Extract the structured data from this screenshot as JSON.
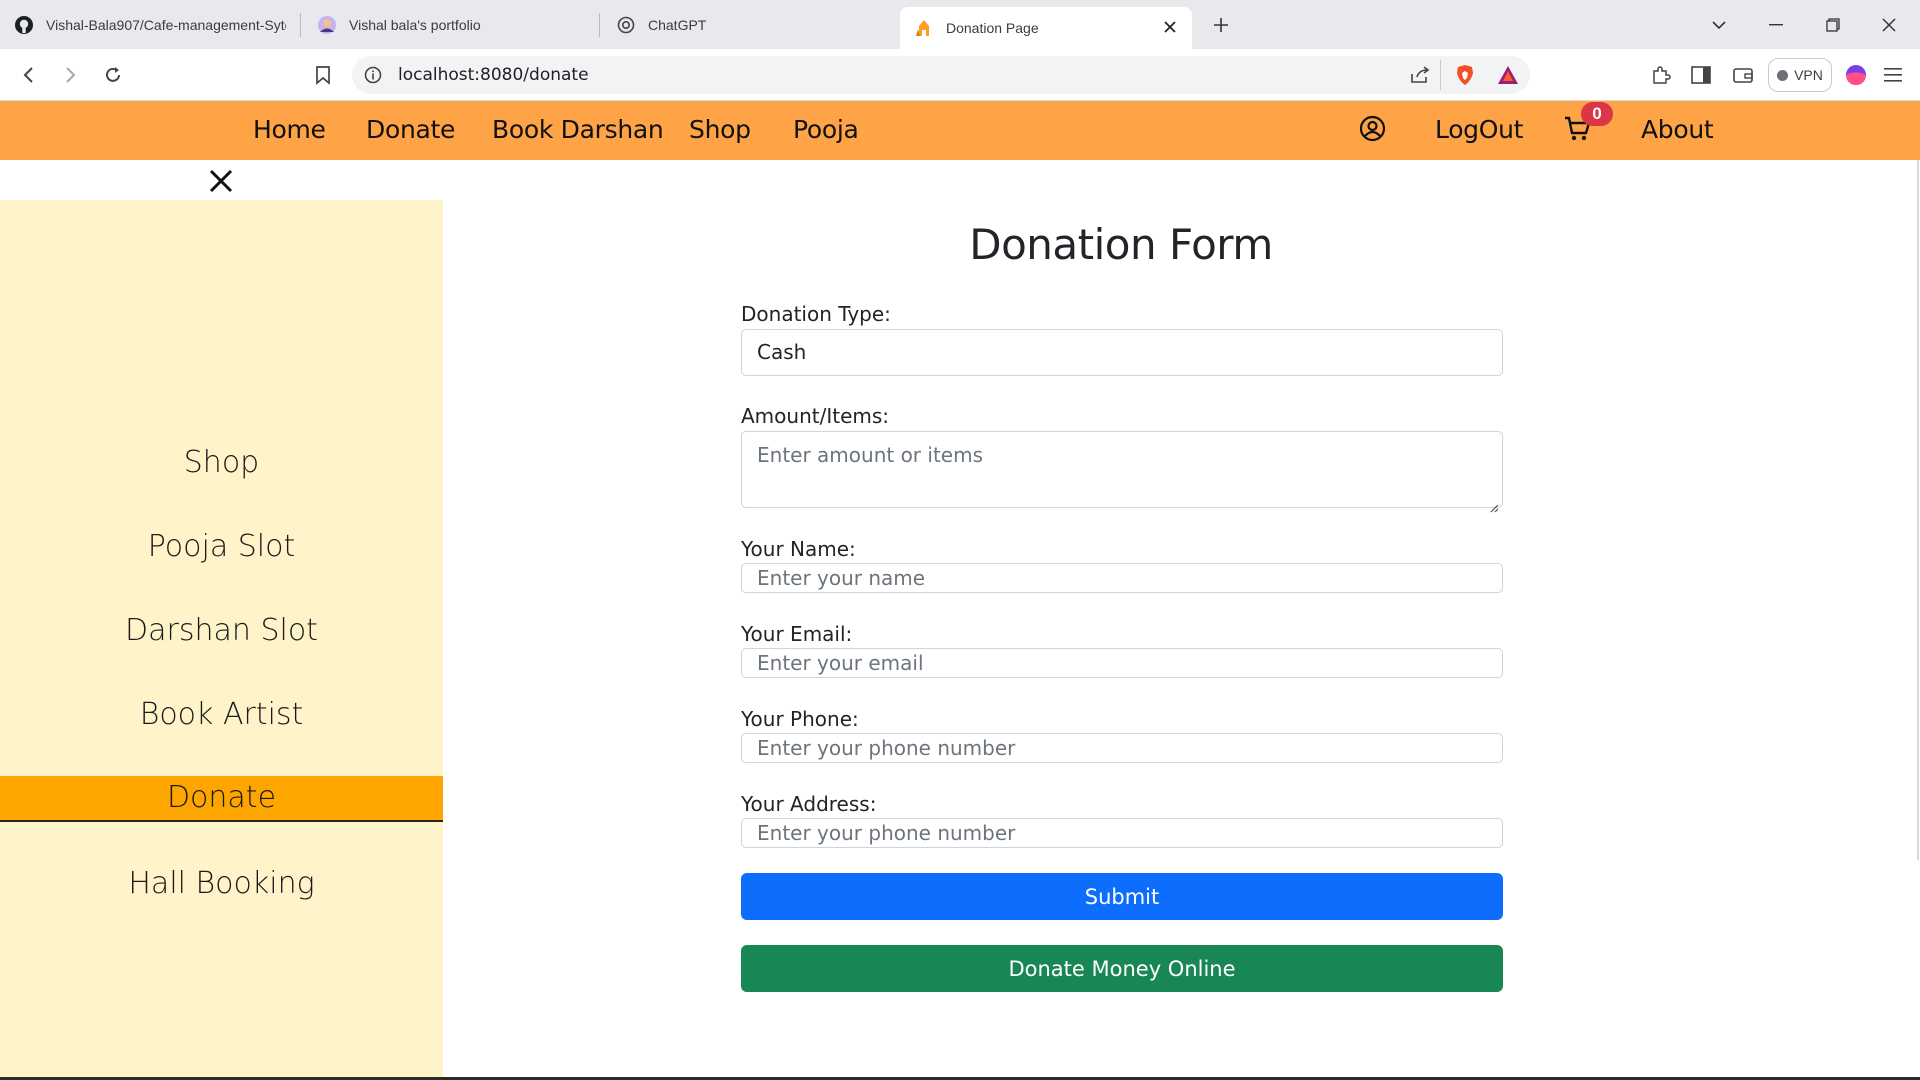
{
  "browser": {
    "tabs": [
      {
        "title": "Vishal-Bala907/Cafe-management-Syte",
        "icon": "github-icon"
      },
      {
        "title": "Vishal bala's portfolio",
        "icon": "avatar-icon"
      },
      {
        "title": "ChatGPT",
        "icon": "chatgpt-icon"
      },
      {
        "title": "Donation Page",
        "icon": "temple-icon",
        "active": true
      }
    ],
    "url": "localhost:8080/donate",
    "vpn_label": "VPN"
  },
  "navbar": {
    "links": [
      "Home",
      "Donate",
      "Book Darshan",
      "Shop",
      "Pooja"
    ],
    "logout": "LogOut",
    "cart_count": "0",
    "about": "About",
    "color": "#ffa347"
  },
  "sidebar": {
    "items": [
      "Shop",
      "Pooja Slot",
      "Darshan Slot",
      "Book Artist",
      "Donate",
      "Hall Booking"
    ],
    "active": "Donate",
    "bg_color": "#fff3c9",
    "active_color": "#ffa500"
  },
  "form": {
    "title": "Donation Form",
    "type_label": "Donation Type:",
    "type_value": "Cash",
    "amount_label": "Amount/Items:",
    "amount_placeholder": "Enter amount or items",
    "name_label": "Your Name:",
    "name_placeholder": "Enter your name",
    "email_label": "Your Email:",
    "email_placeholder": "Enter your email",
    "phone_label": "Your Phone:",
    "phone_placeholder": "Enter your phone number",
    "address_label": "Your Address:",
    "address_placeholder": "Enter your phone number",
    "submit_label": "Submit",
    "online_label": "Donate Money Online",
    "submit_color": "#0d6efd",
    "online_color": "#198754"
  }
}
